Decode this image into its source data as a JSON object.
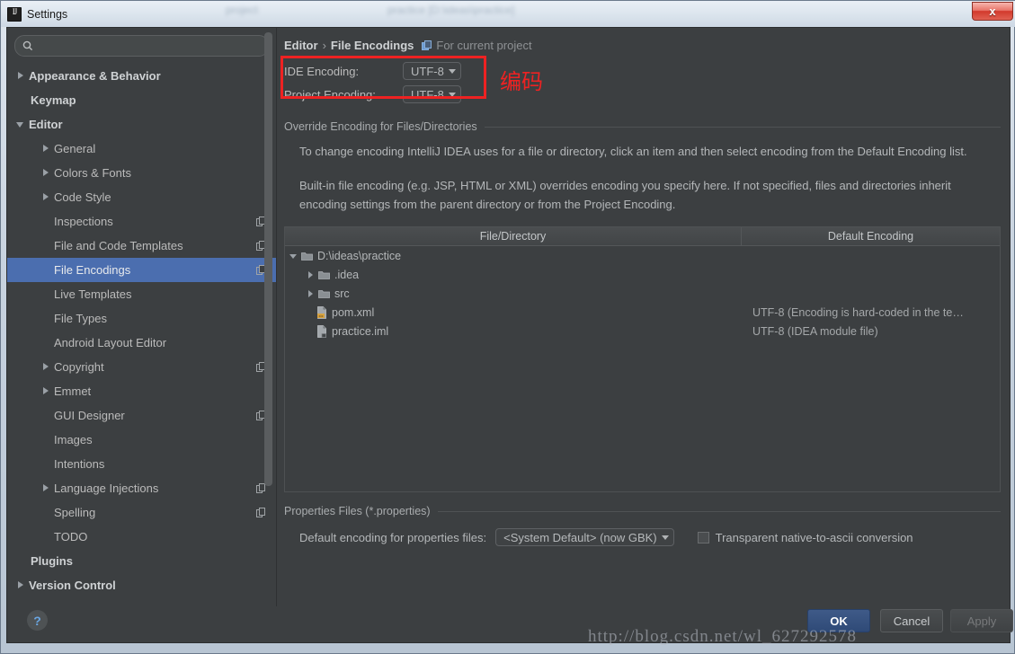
{
  "window": {
    "title": "Settings",
    "app_icon": "intellij-idea-icon",
    "close_label": "x",
    "ghost_text_1": "project",
    "ghost_text_2": "practice [D:\\ideas\\practice]"
  },
  "sidebar": {
    "search": {
      "placeholder": "",
      "value": "",
      "icon": "search-icon"
    },
    "items": [
      {
        "label": "Appearance & Behavior",
        "arrow": "collapsed",
        "bold": true,
        "indent": 10,
        "selected": false,
        "mod_icon": false
      },
      {
        "label": "Keymap",
        "arrow": "none",
        "bold": true,
        "indent": 26,
        "selected": false,
        "mod_icon": false
      },
      {
        "label": "Editor",
        "arrow": "expanded",
        "bold": true,
        "indent": 10,
        "selected": false,
        "mod_icon": false
      },
      {
        "label": "General",
        "arrow": "collapsed",
        "bold": false,
        "indent": 38,
        "selected": false,
        "mod_icon": false
      },
      {
        "label": "Colors & Fonts",
        "arrow": "collapsed",
        "bold": false,
        "indent": 38,
        "selected": false,
        "mod_icon": false
      },
      {
        "label": "Code Style",
        "arrow": "collapsed",
        "bold": false,
        "indent": 38,
        "selected": false,
        "mod_icon": false
      },
      {
        "label": "Inspections",
        "arrow": "none",
        "bold": false,
        "indent": 52,
        "selected": false,
        "mod_icon": true
      },
      {
        "label": "File and Code Templates",
        "arrow": "none",
        "bold": false,
        "indent": 52,
        "selected": false,
        "mod_icon": true
      },
      {
        "label": "File Encodings",
        "arrow": "none",
        "bold": false,
        "indent": 52,
        "selected": true,
        "mod_icon": true
      },
      {
        "label": "Live Templates",
        "arrow": "none",
        "bold": false,
        "indent": 52,
        "selected": false,
        "mod_icon": false
      },
      {
        "label": "File Types",
        "arrow": "none",
        "bold": false,
        "indent": 52,
        "selected": false,
        "mod_icon": false
      },
      {
        "label": "Android Layout Editor",
        "arrow": "none",
        "bold": false,
        "indent": 52,
        "selected": false,
        "mod_icon": false
      },
      {
        "label": "Copyright",
        "arrow": "collapsed",
        "bold": false,
        "indent": 38,
        "selected": false,
        "mod_icon": true
      },
      {
        "label": "Emmet",
        "arrow": "collapsed",
        "bold": false,
        "indent": 38,
        "selected": false,
        "mod_icon": false
      },
      {
        "label": "GUI Designer",
        "arrow": "none",
        "bold": false,
        "indent": 52,
        "selected": false,
        "mod_icon": true
      },
      {
        "label": "Images",
        "arrow": "none",
        "bold": false,
        "indent": 52,
        "selected": false,
        "mod_icon": false
      },
      {
        "label": "Intentions",
        "arrow": "none",
        "bold": false,
        "indent": 52,
        "selected": false,
        "mod_icon": false
      },
      {
        "label": "Language Injections",
        "arrow": "collapsed",
        "bold": false,
        "indent": 38,
        "selected": false,
        "mod_icon": true
      },
      {
        "label": "Spelling",
        "arrow": "none",
        "bold": false,
        "indent": 52,
        "selected": false,
        "mod_icon": true
      },
      {
        "label": "TODO",
        "arrow": "none",
        "bold": false,
        "indent": 52,
        "selected": false,
        "mod_icon": false
      },
      {
        "label": "Plugins",
        "arrow": "none",
        "bold": true,
        "indent": 26,
        "selected": false,
        "mod_icon": false
      },
      {
        "label": "Version Control",
        "arrow": "collapsed",
        "bold": true,
        "indent": 10,
        "selected": false,
        "mod_icon": false
      }
    ]
  },
  "main": {
    "breadcrumb": {
      "parent": "Editor",
      "separator": "›",
      "current": "File Encodings",
      "scope_label": "For current project",
      "scope_icon": "project-scope-icon"
    },
    "encodings": {
      "ide_label": "IDE Encoding:",
      "ide_value": "UTF-8",
      "project_label": "Project Encoding:",
      "project_value": "UTF-8",
      "annotation": "编码",
      "annotation_color": "#ee2222"
    },
    "override_section": {
      "title": "Override Encoding for Files/Directories",
      "paragraph_1": "To change encoding IntelliJ IDEA uses for a file or directory, click an item and then select encoding from the Default Encoding list.",
      "paragraph_2": "Built-in file encoding (e.g. JSP, HTML or XML) overrides encoding you specify here. If not specified, files and directories inherit encoding settings from the parent directory or from the Project Encoding."
    },
    "table": {
      "headers": [
        "File/Directory",
        "Default Encoding"
      ],
      "rows": [
        {
          "name": "D:\\ideas\\practice",
          "encoding": "",
          "arrow": "expanded",
          "icon": "folder-icon",
          "indent": 0
        },
        {
          "name": ".idea",
          "encoding": "",
          "arrow": "collapsed",
          "icon": "folder-icon",
          "indent": 19
        },
        {
          "name": "src",
          "encoding": "",
          "arrow": "collapsed",
          "icon": "folder-icon",
          "indent": 19
        },
        {
          "name": "pom.xml",
          "encoding": "UTF-8 (Encoding is hard-coded in the te…",
          "arrow": "none",
          "icon": "xml-file-icon",
          "indent": 31
        },
        {
          "name": "practice.iml",
          "encoding": "UTF-8 (IDEA module file)",
          "arrow": "none",
          "icon": "module-file-icon",
          "indent": 31
        }
      ]
    },
    "properties_section": {
      "title": "Properties Files (*.properties)",
      "default_encoding_label": "Default encoding for properties files:",
      "default_encoding_value": "<System Default> (now GBK)",
      "checkbox_label": "Transparent native-to-ascii conversion",
      "checkbox_checked": false
    }
  },
  "footer": {
    "help_label": "?",
    "ok_label": "OK",
    "cancel_label": "Cancel",
    "apply_label": "Apply"
  },
  "watermark": "http://blog.csdn.net/wl_627292578"
}
